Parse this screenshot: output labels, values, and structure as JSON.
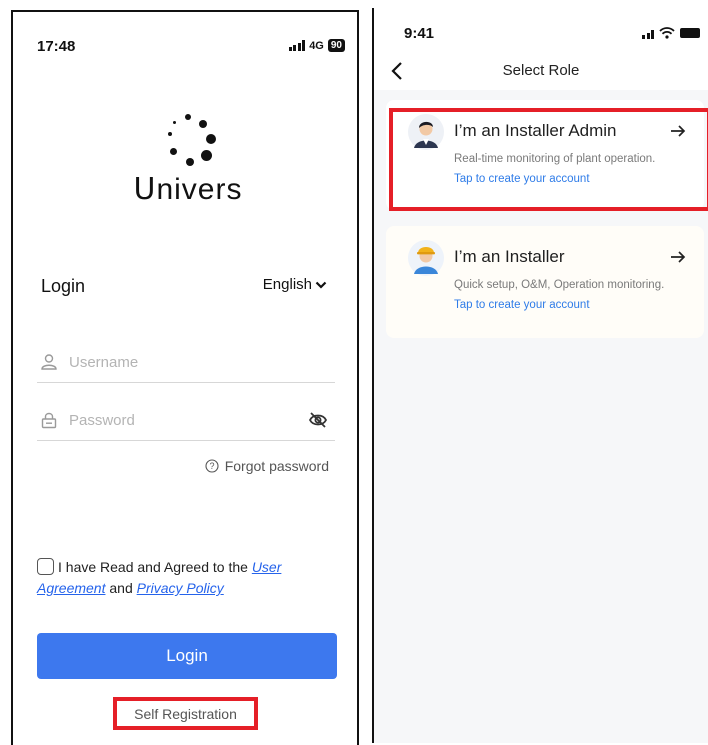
{
  "left": {
    "status": {
      "time": "17:48",
      "network": "4G",
      "battery": "90"
    },
    "logo_text": "ᑌnivers",
    "login_heading": "Login",
    "language": "English",
    "username_placeholder": "Username",
    "password_placeholder": "Password",
    "forgot_password": "Forgot password",
    "agreement": {
      "prefix": "I have Read and Agreed to the ",
      "user_agreement": "User Agreement",
      "and": " and ",
      "privacy_policy": "Privacy Policy"
    },
    "login_button": "Login",
    "self_registration": "Self Registration",
    "accent_color": "#3d78ee",
    "highlight_color": "#e51f27"
  },
  "right": {
    "status": {
      "time": "9:41"
    },
    "nav_title": "Select Role",
    "roles": [
      {
        "title": "I’m an Installer Admin",
        "description": "Real-time monitoring of plant operation.",
        "link": "Tap to create your account",
        "icon": "installer-admin-avatar"
      },
      {
        "title": "I’m an Installer",
        "description": "Quick setup, O&M, Operation monitoring.",
        "link": "Tap to create your account",
        "icon": "installer-avatar"
      }
    ],
    "link_color": "#2f7ce8"
  }
}
